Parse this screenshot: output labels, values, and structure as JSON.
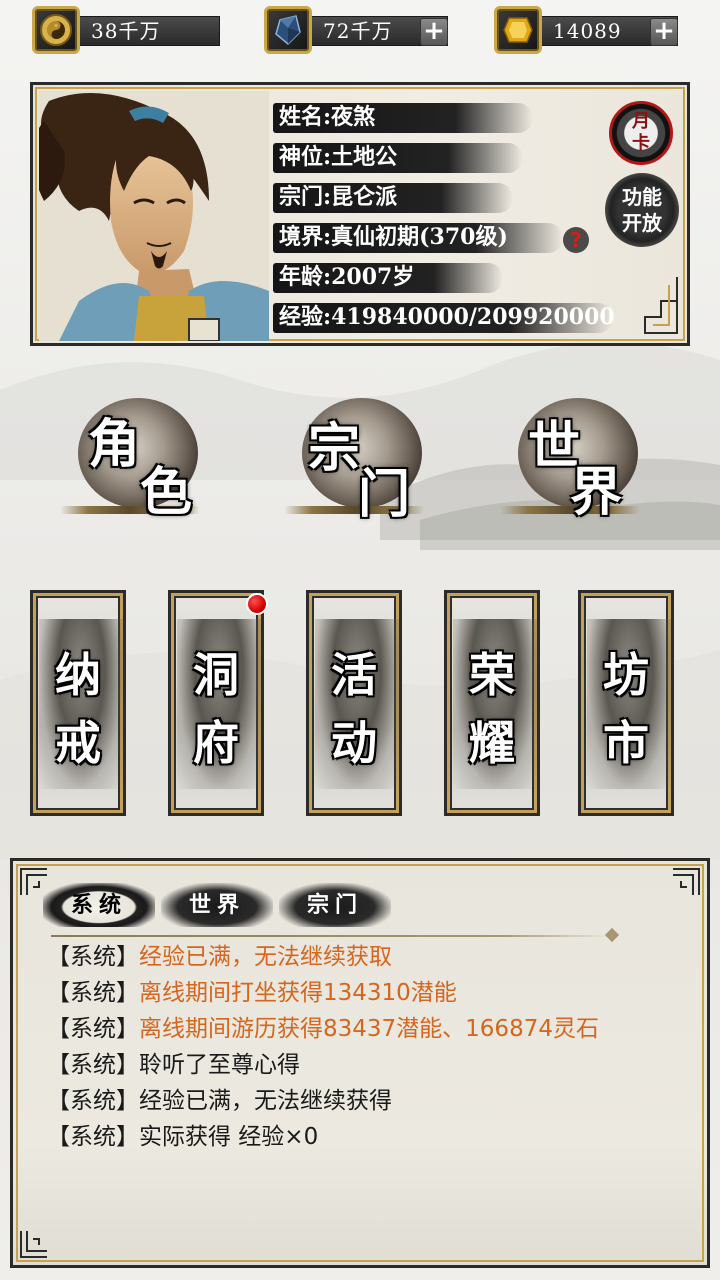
{
  "currency": [
    {
      "name": "copper-coin",
      "amount": "38千万",
      "has_plus": false
    },
    {
      "name": "spirit-crystal",
      "amount": "72千万",
      "has_plus": true,
      "plus_label": "+"
    },
    {
      "name": "gold-ingot",
      "amount": "14089",
      "has_plus": true,
      "plus_label": "+"
    }
  ],
  "character": {
    "rows": [
      {
        "label": "姓名:",
        "value": "夜煞"
      },
      {
        "label": "神位:",
        "value": "土地公"
      },
      {
        "label": "宗门:",
        "value": "昆仑派"
      },
      {
        "label": "境界:",
        "value": "真仙初期(370级)"
      },
      {
        "label": "年龄:",
        "value": "2007岁"
      },
      {
        "label": "经验:",
        "value": "419840000/209920000"
      }
    ],
    "help_label": "?",
    "month_card": {
      "line1": "月",
      "line2": "卡"
    },
    "feature_open": {
      "line1": "功能",
      "line2": "开放"
    }
  },
  "main_buttons": [
    {
      "id": "role",
      "c1": "角",
      "c2": "色"
    },
    {
      "id": "sect",
      "c1": "宗",
      "c2": "门"
    },
    {
      "id": "world",
      "c1": "世",
      "c2": "界"
    }
  ],
  "cards": [
    {
      "id": "ring",
      "c1": "纳",
      "c2": "戒",
      "notify": false
    },
    {
      "id": "cave",
      "c1": "洞",
      "c2": "府",
      "notify": true
    },
    {
      "id": "event",
      "c1": "活",
      "c2": "动",
      "notify": false
    },
    {
      "id": "glory",
      "c1": "荣",
      "c2": "耀",
      "notify": false
    },
    {
      "id": "market",
      "c1": "坊",
      "c2": "市",
      "notify": false
    }
  ],
  "log": {
    "tabs": [
      "系统",
      "世界",
      "宗门"
    ],
    "active_tab": "系统",
    "lines": [
      {
        "tag": "【系统】",
        "msg": "经验已满，无法继续获取",
        "color": "#d4661e"
      },
      {
        "tag": "【系统】",
        "msg": "离线期间打坐获得134310潜能",
        "color": "#d4661e"
      },
      {
        "tag": "【系统】",
        "msg": "离线期间游历获得83437潜能、166874灵石",
        "color": "#d4661e"
      },
      {
        "tag": "【系统】",
        "msg": "聆听了至尊心得",
        "color": "#1a1a1a"
      },
      {
        "tag": "【系统】",
        "msg": "经验已满，无法继续获得",
        "color": "#1a1a1a"
      },
      {
        "tag": "【系统】",
        "msg": "实际获得 经验×0",
        "color": "#1a1a1a"
      }
    ]
  }
}
